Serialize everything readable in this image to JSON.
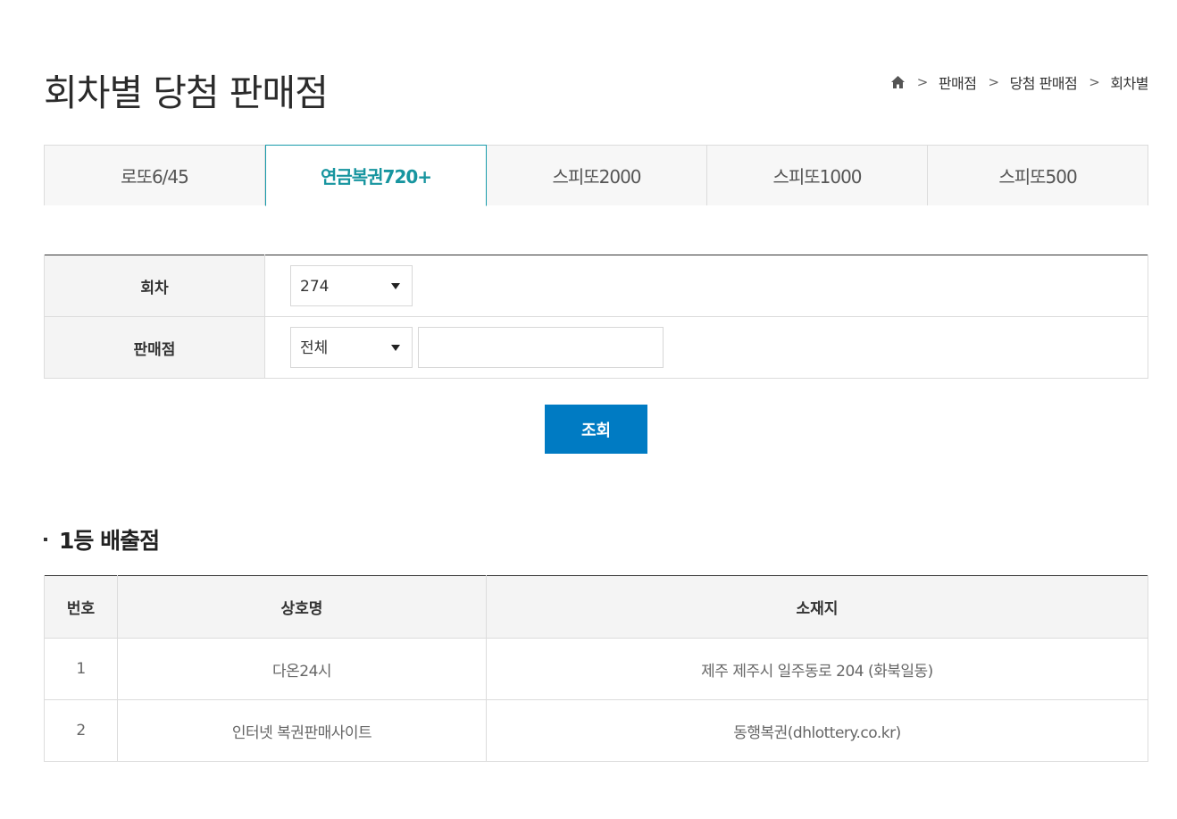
{
  "page": {
    "title": "회차별 당첨 판매점"
  },
  "breadcrumb": {
    "items": [
      "판매점",
      "당첨 판매점",
      "회차별"
    ]
  },
  "tabs": [
    "로또6/45",
    "연금복권720+",
    "스피또2000",
    "스피또1000",
    "스피또500"
  ],
  "active_tab_index": 1,
  "search": {
    "round_label": "회차",
    "round_value": "274",
    "store_label": "판매점",
    "store_filter_value": "전체",
    "store_text_value": "",
    "submit_label": "조회"
  },
  "results": {
    "section_title": "1등 배출점",
    "headers": {
      "no": "번호",
      "name": "상호명",
      "address": "소재지"
    },
    "rows": [
      {
        "no": "1",
        "name": "다온24시",
        "address": "제주 제주시 일주동로 204 (화북일동)"
      },
      {
        "no": "2",
        "name": "인터넷 복권판매사이트",
        "address": "동행복권(dhlottery.co.kr)"
      }
    ]
  },
  "colors": {
    "accent_teal": "#17959f",
    "button_blue": "#007bc3"
  }
}
